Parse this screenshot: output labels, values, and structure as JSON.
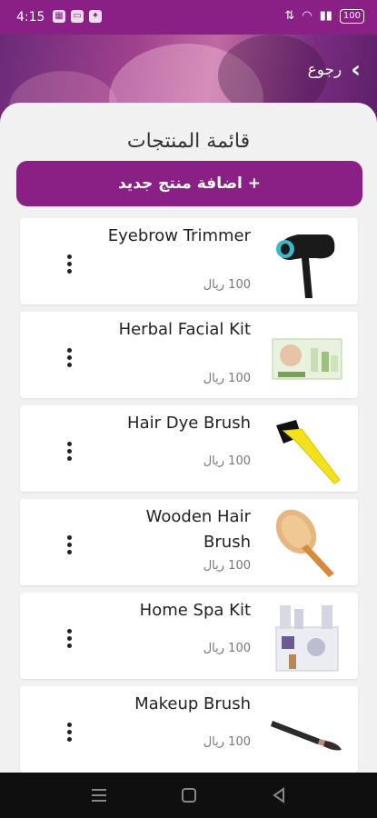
{
  "status_bar": {
    "time": "4:15",
    "battery": "100"
  },
  "header": {
    "back_label": "رجوع"
  },
  "page": {
    "title": "قائمة المنتجات",
    "add_button_label": "اضافة منتج جديد  +"
  },
  "products": [
    {
      "name": "Eyebrow Trimmer",
      "price": "100 ريال",
      "icon": "hair-dryer-icon"
    },
    {
      "name": "Herbal Facial Kit",
      "price": "100 ريال",
      "icon": "facial-kit-icon"
    },
    {
      "name": "Hair Dye Brush",
      "price": "100 ريال",
      "icon": "dye-brush-icon"
    },
    {
      "name": "Wooden Hair Brush",
      "price": "100 ريال",
      "icon": "wooden-brush-icon"
    },
    {
      "name": "Home Spa Kit",
      "price": "100 ريال",
      "icon": "spa-kit-icon"
    },
    {
      "name": "Makeup Brush",
      "price": "100 ريال",
      "icon": "makeup-brush-icon"
    }
  ],
  "colors": {
    "primary": "#8a1f86",
    "nav_bar": "#0f0f0f",
    "background": "#f1f1f1"
  }
}
